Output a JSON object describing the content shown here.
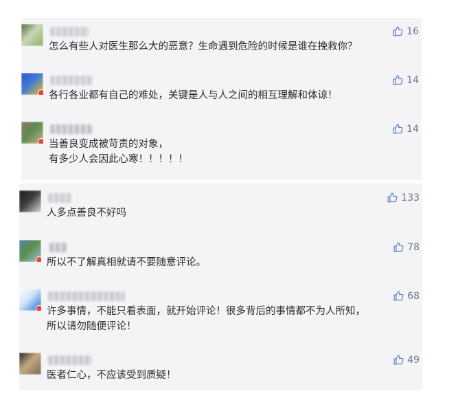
{
  "comments": [
    {
      "text": [
        "怎么有些人对医生那么大的恶意？生命遇到危险的时候是谁在挽救你？"
      ],
      "likes": "16",
      "avatar_colors": [
        "#4d6b3a",
        "#8fae6a",
        "#c7d9b4"
      ],
      "username_color": "#c9c9cf",
      "badge": ""
    },
    {
      "text": [
        "各行各业都有自己的难处，关键是人与人之间的相互理解和体谅！"
      ],
      "likes": "14",
      "avatar_colors": [
        "#2a55c7",
        "#f2c316",
        "#3c7bd9"
      ],
      "username_color": "#c8c9cf",
      "badge": "#e7463a"
    },
    {
      "text": [
        "当善良变成被苛责的对象，",
        "有多少人会因此心寒！！！！！"
      ],
      "likes": "14",
      "avatar_colors": [
        "#8a7a5f",
        "#c6b28e",
        "#5e8a4e"
      ],
      "username_color": "#b9bac0",
      "badge": "#e7463a"
    },
    {
      "text": [
        "人多点善良不好吗"
      ],
      "likes": "133",
      "avatar_colors": [
        "#1a1a1a",
        "#d9d9d9",
        "#3c3c3c"
      ],
      "username_color": "#c7c8cd",
      "badge": ""
    },
    {
      "text": [
        "所以不了解真相就请不要随意评论。"
      ],
      "likes": "78",
      "avatar_colors": [
        "#4e7fb0",
        "#9cc2e0",
        "#5c8e4a"
      ],
      "username_color": "#b7b9bf",
      "badge": "#e7463a"
    },
    {
      "text": [
        "许多事情，不能只看表面，就开始评论！很多背后的事情都不为人所知，",
        "所以请勿随便评论！"
      ],
      "likes": "68",
      "avatar_colors": [
        "#ffffff",
        "#1e6fd6",
        "#cfe2f7"
      ],
      "username_color": "#c4c5cb",
      "badge": "#e7463a"
    },
    {
      "text": [
        "医者仁心，不应该受到质疑！"
      ],
      "likes": "49",
      "avatar_colors": [
        "#222222",
        "#7a6a55",
        "#c5a882"
      ],
      "username_color": "#c3c4ca",
      "badge": ""
    }
  ]
}
